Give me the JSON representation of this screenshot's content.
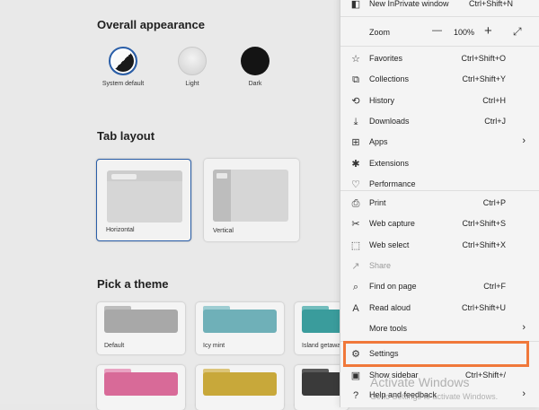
{
  "appearance": {
    "heading": "Overall appearance",
    "options": [
      {
        "label": "System default"
      },
      {
        "label": "Light"
      },
      {
        "label": "Dark"
      }
    ]
  },
  "tab_layout": {
    "heading": "Tab layout",
    "options": [
      {
        "label": "Horizontal"
      },
      {
        "label": "Vertical"
      }
    ]
  },
  "themes": {
    "heading": "Pick a theme",
    "items": [
      {
        "label": "Default",
        "color": "#a8a8a8"
      },
      {
        "label": "Icy mint",
        "color": "#6fb0b8"
      },
      {
        "label": "Island getaway",
        "color": "#3a9c9c"
      },
      {
        "label": "",
        "color": "#d86a98"
      },
      {
        "label": "",
        "color": "#c8a83a"
      },
      {
        "label": "",
        "color": "#3a3a3a"
      }
    ]
  },
  "menu": {
    "inprivate": {
      "label": "New InPrivate window",
      "shortcut": "Ctrl+Shift+N"
    },
    "zoom": {
      "label": "Zoom",
      "minus": "—",
      "value": "100%",
      "plus": "+"
    },
    "items": [
      {
        "label": "Favorites",
        "shortcut": "Ctrl+Shift+O",
        "icon": "☆"
      },
      {
        "label": "Collections",
        "shortcut": "Ctrl+Shift+Y",
        "icon": "⧉"
      },
      {
        "label": "History",
        "shortcut": "Ctrl+H",
        "icon": "⟲"
      },
      {
        "label": "Downloads",
        "shortcut": "Ctrl+J",
        "icon": "⤓"
      },
      {
        "label": "Apps",
        "shortcut": "",
        "icon": "⊞",
        "submenu": true
      },
      {
        "label": "Extensions",
        "shortcut": "",
        "icon": "✱"
      },
      {
        "label": "Performance",
        "shortcut": "",
        "icon": "♡"
      }
    ],
    "items2": [
      {
        "label": "Print",
        "shortcut": "Ctrl+P",
        "icon": "⎙"
      },
      {
        "label": "Web capture",
        "shortcut": "Ctrl+Shift+S",
        "icon": "✂"
      },
      {
        "label": "Web select",
        "shortcut": "Ctrl+Shift+X",
        "icon": "⬚"
      },
      {
        "label": "Share",
        "shortcut": "",
        "icon": "↗",
        "disabled": true
      },
      {
        "label": "Find on page",
        "shortcut": "Ctrl+F",
        "icon": "⌕"
      },
      {
        "label": "Read aloud",
        "shortcut": "Ctrl+Shift+U",
        "icon": "A"
      },
      {
        "label": "More tools",
        "shortcut": "",
        "icon": "",
        "submenu": true
      }
    ],
    "settings": {
      "label": "Settings",
      "icon": "⚙"
    },
    "sidebar": {
      "label": "Show sidebar",
      "shortcut": "Ctrl+Shift+/",
      "icon": "▣"
    },
    "help": {
      "label": "Help and feedback",
      "icon": "?"
    }
  },
  "watermark": {
    "title": "Activate Windows",
    "subtitle": "Go to Settings to activate Windows."
  },
  "colors": {
    "highlight": "#f0783a",
    "selected_border": "#2a5ea8"
  }
}
